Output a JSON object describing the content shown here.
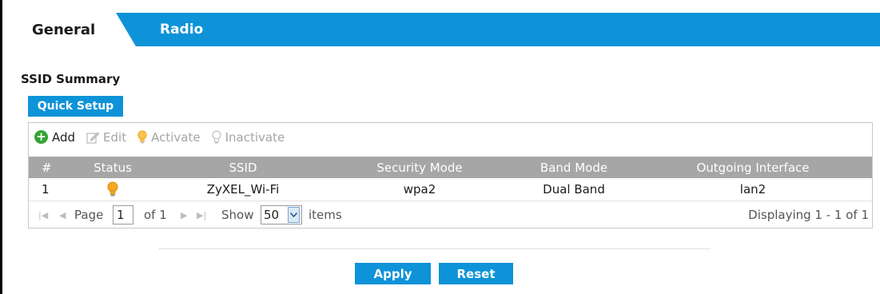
{
  "tabs": [
    {
      "label": "General",
      "active": true
    },
    {
      "label": "Radio",
      "active": false
    }
  ],
  "section": {
    "title": "SSID Summary"
  },
  "quick_setup_label": "Quick Setup",
  "toolbar": {
    "add": "Add",
    "edit": "Edit",
    "activate": "Activate",
    "inactivate": "Inactivate"
  },
  "table": {
    "headers": [
      "#",
      "Status",
      "SSID",
      "Security Mode",
      "Band Mode",
      "Outgoing Interface"
    ],
    "rows": [
      {
        "num": "1",
        "status_icon": "bulb-on-icon",
        "ssid": "ZyXEL_Wi-Fi",
        "security": "wpa2",
        "band": "Dual Band",
        "interface": "lan2"
      }
    ]
  },
  "pager": {
    "page_label": "Page",
    "page_value": "1",
    "of_label": "of 1",
    "show_label": "Show",
    "show_value": "50",
    "items_label": "items",
    "displaying": "Displaying 1 - 1 of 1"
  },
  "buttons": {
    "apply": "Apply",
    "reset": "Reset"
  },
  "colors": {
    "accent": "#0e93d8",
    "header_bg": "#a6a6a6",
    "add_green": "#34a534",
    "bulb_on": "#f5a623",
    "disabled": "#a5a5a5"
  }
}
